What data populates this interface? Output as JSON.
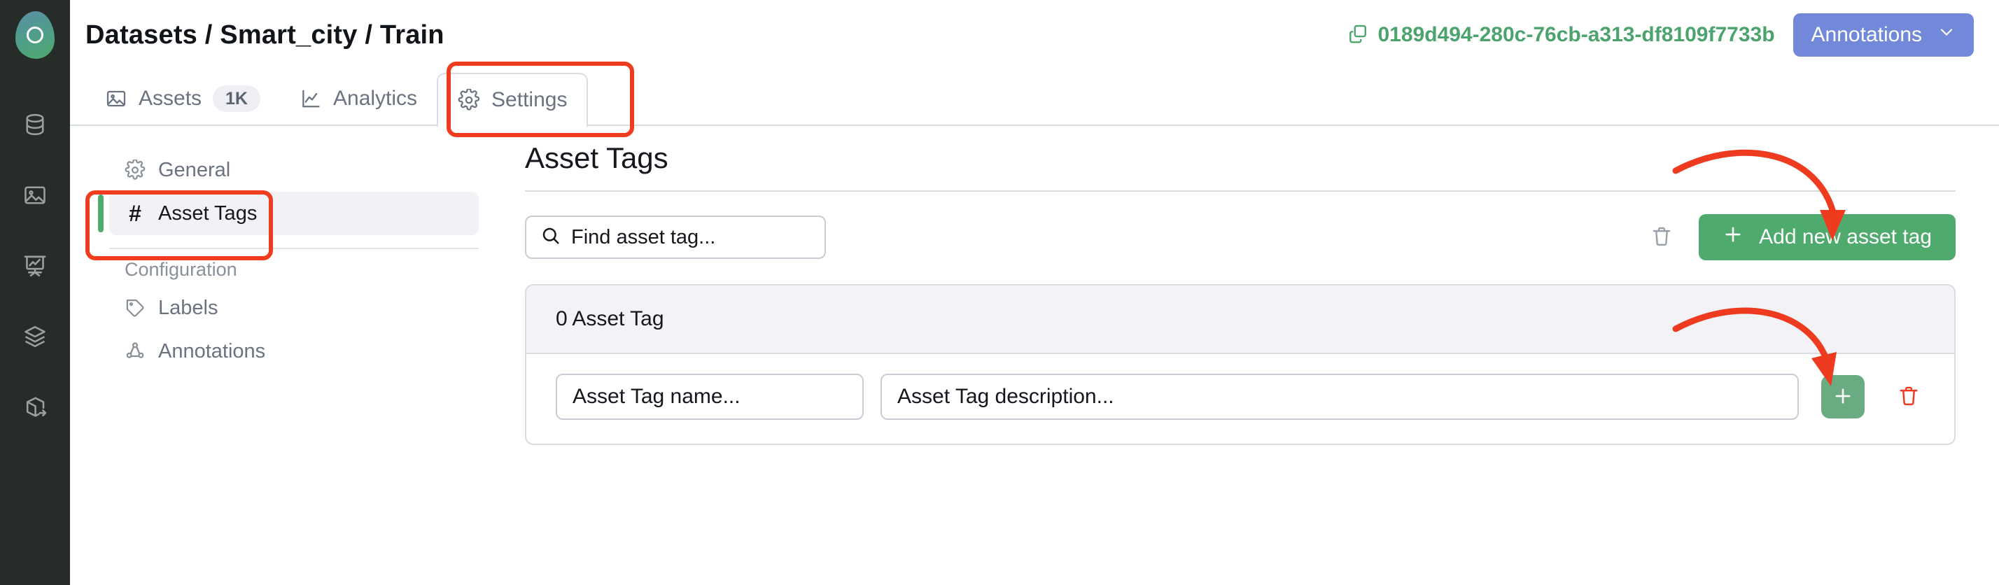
{
  "app": {
    "logo_name": "app-logo",
    "rail_icons": [
      {
        "name": "database-icon",
        "label": "Datasets"
      },
      {
        "name": "image-icon",
        "label": "Assets"
      },
      {
        "name": "presentation-chart-icon",
        "label": "Analytics"
      },
      {
        "name": "layers-icon",
        "label": "Models"
      },
      {
        "name": "box-arrow-icon",
        "label": "Deployments"
      }
    ]
  },
  "header": {
    "breadcrumb": "Datasets / Smart_city / Train",
    "uuid": "0189d494-280c-76cb-a313-df8109f7733b",
    "copy_icon": "copy-icon",
    "annotations_button": "Annotations",
    "annotations_chevron": "chevron-down-icon"
  },
  "tabs": [
    {
      "label": "Assets",
      "icon": "image-icon",
      "badge": "1K",
      "active": false
    },
    {
      "label": "Analytics",
      "icon": "line-chart-icon",
      "badge": "",
      "active": false
    },
    {
      "label": "Settings",
      "icon": "gear-icon",
      "badge": "",
      "active": true
    }
  ],
  "sidebar": {
    "items": [
      {
        "label": "General",
        "icon": "gear-icon",
        "active": false
      },
      {
        "label": "Asset Tags",
        "icon": "hash-icon",
        "active": true
      }
    ],
    "section_label": "Configuration",
    "config_items": [
      {
        "label": "Labels",
        "icon": "tag-icon",
        "active": false
      },
      {
        "label": "Annotations",
        "icon": "nodes-icon",
        "active": false
      }
    ]
  },
  "main": {
    "title": "Asset Tags",
    "search": {
      "placeholder": "Find asset tag...",
      "value": "",
      "icon": "search-icon"
    },
    "delete_icon": "trash-icon",
    "add_button": {
      "label": "Add new asset tag",
      "icon": "plus-icon"
    },
    "card": {
      "count_label": "0 Asset Tag",
      "name_field": {
        "placeholder": "Asset Tag name...",
        "value": ""
      },
      "description_field": {
        "placeholder": "Asset Tag description...",
        "value": ""
      },
      "confirm_icon": "plus-icon",
      "remove_icon": "trash-icon"
    }
  },
  "annotations": {
    "highlight_color": "#f03c1e",
    "arrow_color": "#ee3b20",
    "accent_green": "#4faa6d",
    "accent_blue": "#7289d9",
    "rail_bg": "#262d29",
    "markers": [
      {
        "name": "settings-tab-highlight",
        "shape": "rectangle"
      },
      {
        "name": "asset-tags-nav-highlight",
        "shape": "rectangle"
      },
      {
        "name": "add-new-asset-tag-arrow",
        "shape": "curved-arrow"
      },
      {
        "name": "confirm-plus-arrow",
        "shape": "curved-arrow"
      }
    ]
  }
}
